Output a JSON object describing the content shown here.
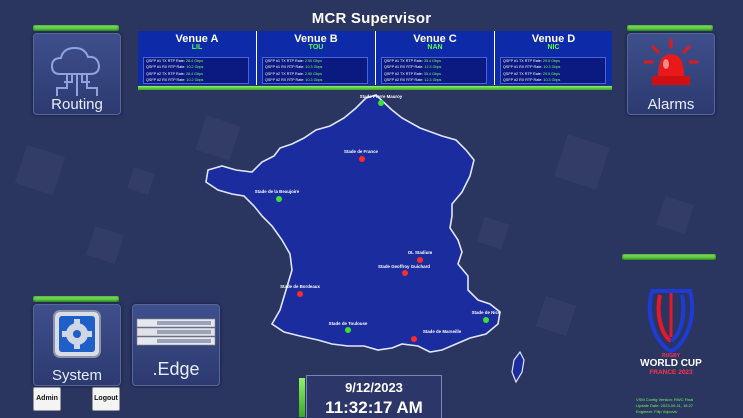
{
  "app": {
    "title": "MCR Supervisor"
  },
  "tiles": {
    "routing": {
      "label": "Routing",
      "icon": "routing-network-cloud-icon"
    },
    "alarms": {
      "label": "Alarms",
      "icon": "alarm-siren-icon"
    },
    "system": {
      "label": "System",
      "icon": "system-gear-icon"
    },
    "edge": {
      "label": ".Edge",
      "icon": "edge-server-rack-icon"
    }
  },
  "buttons": {
    "admin": "Admin",
    "logout": "Logout"
  },
  "venues": [
    {
      "name": "Venue A",
      "code": "LIL",
      "rates": [
        {
          "label": "QSFP #1 TX RTP Rate:",
          "value": "28.4 Gbps"
        },
        {
          "label": "QSFP #1 RX RTP Rate:",
          "value": "10.2 Gbps"
        },
        {
          "label": "QSFP #2 TX RTP Rate:",
          "value": "28.4 Gbps"
        },
        {
          "label": "QSFP #2 RX RTP Rate:",
          "value": "10.2 Gbps"
        }
      ]
    },
    {
      "name": "Venue B",
      "code": "TOU",
      "rates": [
        {
          "label": "QSFP #1 TX RTP Rate:",
          "value": "2.90 Gbps"
        },
        {
          "label": "QSFP #1 RX RTP Rate:",
          "value": "10.3 Gbps"
        },
        {
          "label": "QSFP #2 TX RTP Rate:",
          "value": "2.90 Gbps"
        },
        {
          "label": "QSFP #2 RX RTP Rate:",
          "value": "10.3 Gbps"
        }
      ]
    },
    {
      "name": "Venue C",
      "code": "NAN",
      "rates": [
        {
          "label": "QSFP #1 TX RTP Rate:",
          "value": "35.4 Gbps"
        },
        {
          "label": "QSFP #1 RX RTP Rate:",
          "value": "12.3 Gbps"
        },
        {
          "label": "QSFP #2 TX RTP Rate:",
          "value": "35.4 Gbps"
        },
        {
          "label": "QSFP #2 RX RTP Rate:",
          "value": "12.3 Gbps"
        }
      ]
    },
    {
      "name": "Venue D",
      "code": "NIC",
      "rates": [
        {
          "label": "QSFP #1 TX RTP Rate:",
          "value": "29.5 Gbps"
        },
        {
          "label": "QSFP #1 RX RTP Rate:",
          "value": "10.3 Gbps"
        },
        {
          "label": "QSFP #2 TX RTP Rate:",
          "value": "29.5 Gbps"
        },
        {
          "label": "QSFP #2 RX RTP Rate:",
          "value": "10.3 Gbps"
        }
      ]
    }
  ],
  "stadiums": [
    {
      "name": "Stade Pierre Mauroy",
      "status": "ok"
    },
    {
      "name": "Stade de France",
      "status": "error"
    },
    {
      "name": "Stade de la Beaujoire",
      "status": "ok"
    },
    {
      "name": "OL Stadium",
      "status": "error"
    },
    {
      "name": "Stade Geoffroy Guichard",
      "status": "error"
    },
    {
      "name": "Stade de Bordeaux",
      "status": "error"
    },
    {
      "name": "Stade de Nice",
      "status": "ok"
    },
    {
      "name": "Stade de Toulouse",
      "status": "ok"
    },
    {
      "name": "Stade de Marseille",
      "status": "error"
    }
  ],
  "colors": {
    "ok": "#3ee03a",
    "error": "#ff2a2a",
    "map_fill": "#1a2c9e",
    "accent_green": "#5cff4a"
  },
  "clock": {
    "date": "9/12/2023",
    "time": "11:32:17 AM"
  },
  "logo": {
    "line1": "RUGBY",
    "line2": "WORLD CUP",
    "line3": "FRANCE 2023"
  },
  "footer": {
    "version": "VSM Config Version: RWC Final",
    "updated": "Update Date: 2023-09-11, 16:27",
    "engineer": "Engineer: Filip Vojcovic"
  }
}
